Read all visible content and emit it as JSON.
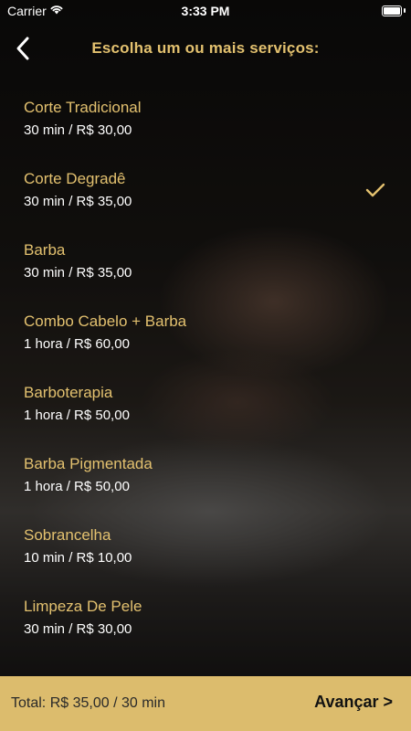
{
  "status_bar": {
    "carrier": "Carrier",
    "time": "3:33 PM"
  },
  "nav": {
    "title": "Escolha um ou mais serviços:"
  },
  "services": [
    {
      "name": "Corte Tradicional",
      "detail": "30 min / R$ 30,00",
      "selected": false
    },
    {
      "name": "Corte Degradê",
      "detail": "30 min / R$ 35,00",
      "selected": true
    },
    {
      "name": "Barba",
      "detail": "30 min / R$ 35,00",
      "selected": false
    },
    {
      "name": "Combo Cabelo + Barba",
      "detail": "1 hora / R$ 60,00",
      "selected": false
    },
    {
      "name": "Barboterapia",
      "detail": "1 hora / R$ 50,00",
      "selected": false
    },
    {
      "name": "Barba Pigmentada",
      "detail": "1 hora / R$ 50,00",
      "selected": false
    },
    {
      "name": "Sobrancelha",
      "detail": "10 min / R$ 10,00",
      "selected": false
    },
    {
      "name": "Limpeza De Pele",
      "detail": "30 min / R$ 30,00",
      "selected": false
    }
  ],
  "footer": {
    "total": "Total: R$ 35,00 / 30 min",
    "next_label": "Avançar >"
  },
  "colors": {
    "accent": "#e3c16f",
    "footer_bg": "#dcbc6d"
  },
  "icons": {
    "back": "chevron-left-icon",
    "check": "check-icon",
    "wifi": "wifi-icon",
    "battery": "battery-icon"
  }
}
